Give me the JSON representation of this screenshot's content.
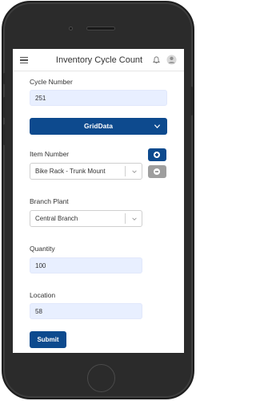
{
  "header": {
    "title": "Inventory Cycle Count",
    "menu_icon": "hamburger-menu-icon",
    "bell_icon": "bell-icon",
    "user_icon": "user-avatar-icon"
  },
  "form": {
    "cycle_number": {
      "label": "Cycle Number",
      "value": "251"
    },
    "griddata": {
      "label": "GridData",
      "icon": "chevron-down-icon"
    },
    "item_number": {
      "label": "Item Number",
      "value": "Bike Rack - Trunk Mount"
    },
    "branch_plant": {
      "label": "Branch Plant",
      "value": "Central Branch"
    },
    "quantity": {
      "label": "Quantity",
      "value": "100"
    },
    "location": {
      "label": "Location",
      "value": "58"
    },
    "submit_label": "Submit"
  },
  "colors": {
    "primary": "#0d4a8e",
    "input_bg": "#e8efff",
    "add_button": "#0d4a8e",
    "remove_button": "#9e9e9e"
  }
}
